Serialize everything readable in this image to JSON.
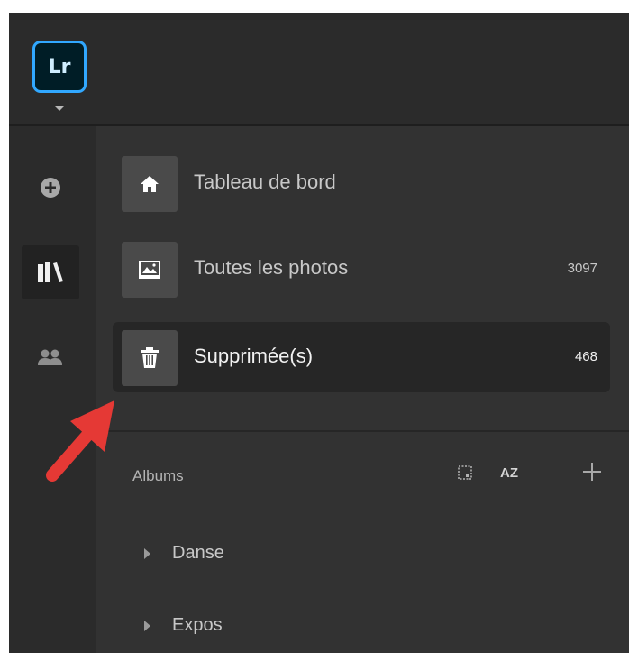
{
  "app": {
    "logo_text": "Lr"
  },
  "nav": {
    "items": [
      {
        "label": "Tableau de bord",
        "count": "",
        "icon": "home-icon"
      },
      {
        "label": "Toutes les photos",
        "count": "3097",
        "icon": "photos-icon"
      },
      {
        "label": "Supprimée(s)",
        "count": "468",
        "icon": "trash-icon",
        "selected": true
      }
    ]
  },
  "albums": {
    "title": "Albums",
    "sort_label": "AZ",
    "items": [
      {
        "label": "Danse"
      },
      {
        "label": "Expos"
      }
    ]
  },
  "colors": {
    "accent": "#31a8ff",
    "callout": "#e53935"
  }
}
